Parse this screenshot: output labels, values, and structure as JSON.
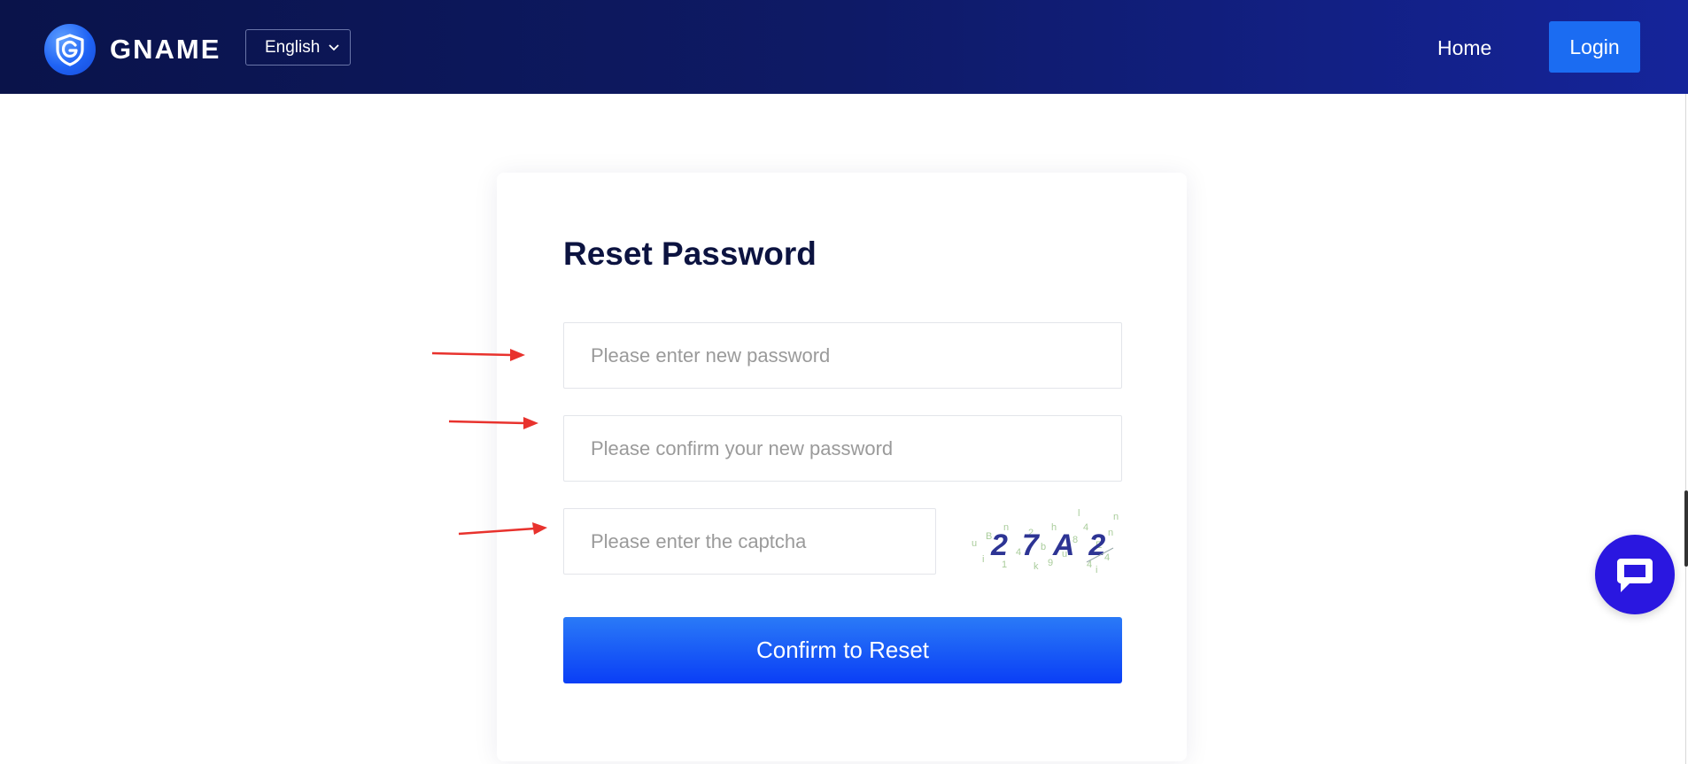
{
  "header": {
    "brand": "GNAME",
    "language": "English",
    "nav_home": "Home",
    "login_label": "Login"
  },
  "form": {
    "title": "Reset Password",
    "new_password_placeholder": "Please enter new password",
    "confirm_password_placeholder": "Please confirm your new password",
    "captcha_placeholder": "Please enter the captcha",
    "captcha_text": "27A2",
    "submit_label": "Confirm to Reset"
  },
  "icons": {
    "logo": "shield-g-logo-icon",
    "language_chevron": "chevron-down-icon",
    "chat": "chat-bubble-icon",
    "annotation": "red-arrow-icon"
  },
  "colors": {
    "header_start": "#0a134a",
    "header_end": "#15249a",
    "login_button": "#1b6cf2",
    "primary_button": "#0a3ef6",
    "title_text": "#0c1340",
    "chat_button": "#2a17e0",
    "annotation_arrow": "#e8322d"
  }
}
